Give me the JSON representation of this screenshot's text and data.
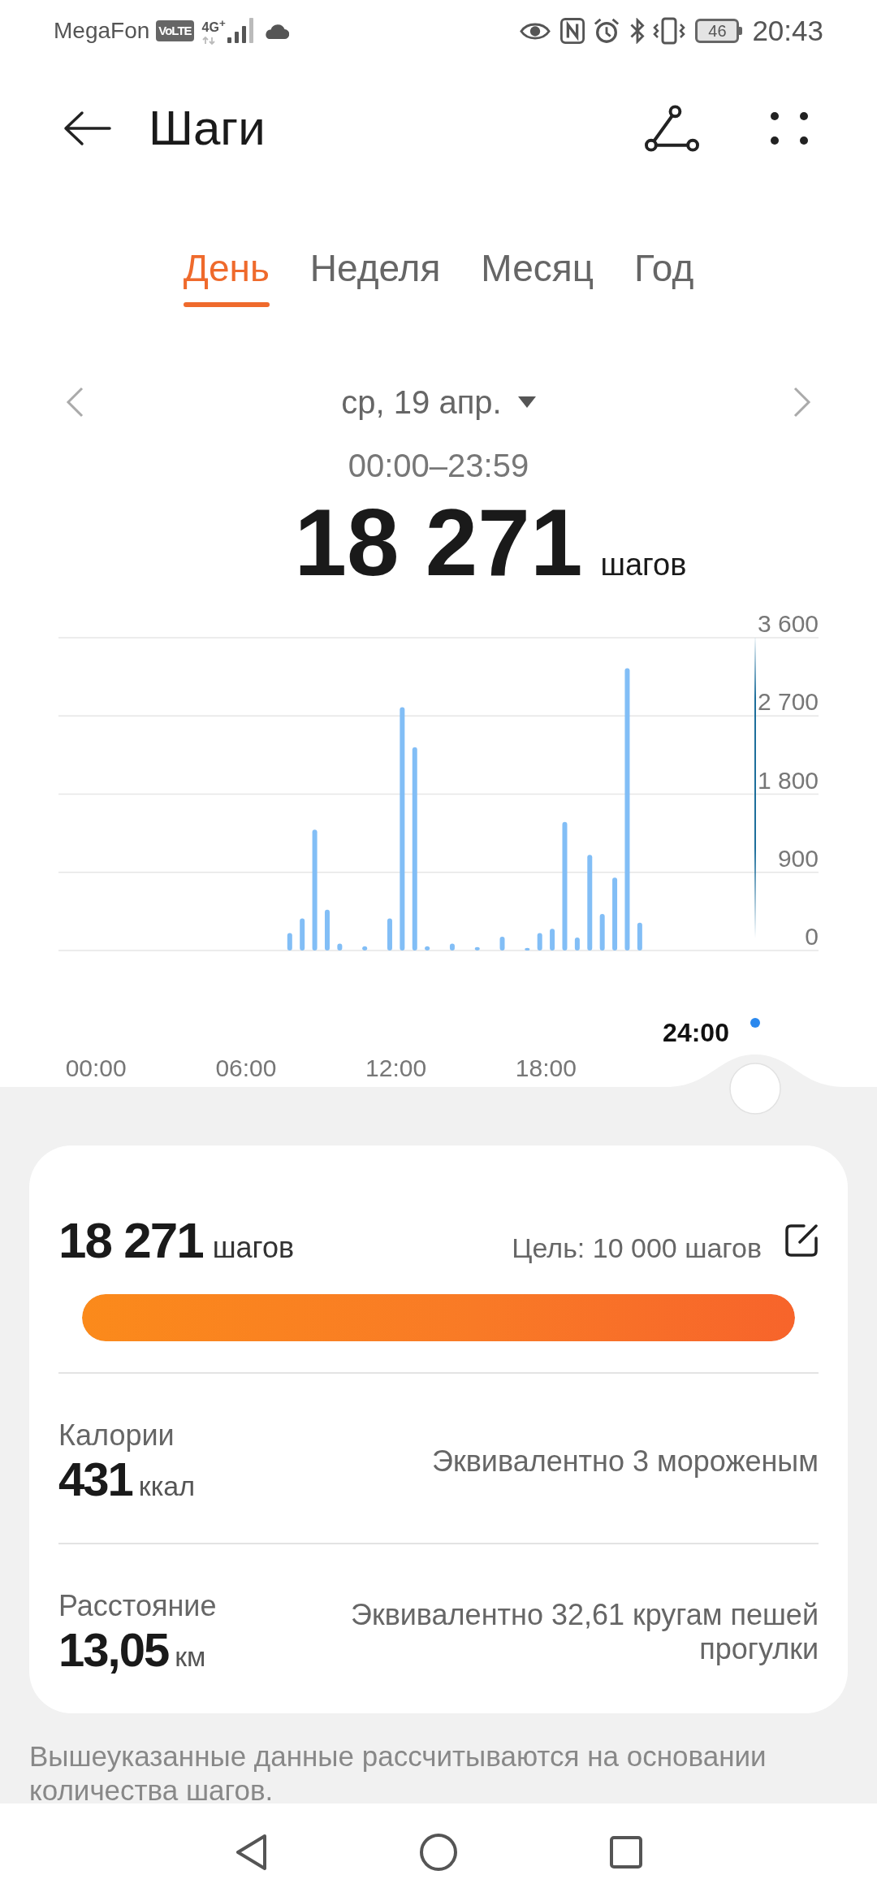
{
  "status_bar": {
    "carrier": "MegaFon",
    "volte": "VoLTE",
    "network": "4G$^{+}$",
    "battery": "46",
    "time": "20:43"
  },
  "header": {
    "title": "Шаги"
  },
  "tabs": [
    {
      "label": "День",
      "selected": true
    },
    {
      "label": "Неделя",
      "selected": false
    },
    {
      "label": "Месяц",
      "selected": false
    },
    {
      "label": "Год",
      "selected": false
    }
  ],
  "date_nav": {
    "date": "ср, 19 апр."
  },
  "summary": {
    "time_range": "00:00–23:59",
    "steps": "18 271",
    "unit": "шагов"
  },
  "chart": {
    "cursor_label": "24:00",
    "chart_data": {
      "type": "bar",
      "grid": true,
      "x": [
        7.75,
        8.25,
        8.75,
        9.25,
        9.75,
        10.75,
        11.75,
        12.25,
        12.75,
        13.25,
        14.25,
        15.25,
        16.25,
        17.25,
        17.75,
        18.25,
        18.75,
        19.25,
        19.75,
        20.25,
        20.75,
        21.25,
        21.75
      ],
      "values": [
        200,
        370,
        1390,
        470,
        80,
        50,
        370,
        2800,
        2340,
        50,
        80,
        40,
        160,
        30,
        200,
        250,
        1480,
        150,
        1100,
        420,
        840,
        3250,
        320
      ],
      "xlim": [
        -1.5,
        28.9
      ],
      "ylim": [
        0,
        3600
      ],
      "xticks": [
        {
          "value": 0,
          "label": "00:00"
        },
        {
          "value": 6,
          "label": "06:00"
        },
        {
          "value": 12,
          "label": "12:00"
        },
        {
          "value": 18,
          "label": "18:00"
        }
      ],
      "yticks": [
        {
          "value": 0,
          "label": "0"
        },
        {
          "value": 900,
          "label": "900"
        },
        {
          "value": 1800,
          "label": "1 800"
        },
        {
          "value": 2700,
          "label": "2 700"
        },
        {
          "value": 3600,
          "label": "3 600"
        }
      ]
    }
  },
  "card": {
    "steps": "18 271",
    "unit": "шагов",
    "goal": "Цель: 10 000 шагов",
    "level": 1,
    "metrics": [
      {
        "label": "Калории",
        "value": "431",
        "unit": "ккал",
        "equivalent": "Эквивалентно 3 мороженым"
      },
      {
        "label": "Расстояние",
        "value": "13,05",
        "unit": "км",
        "equivalent": "Эквивалентно 32,61 кругам пешей прогулки"
      }
    ]
  },
  "footnote": "Вышеуказанные данные рассчитываются на основании количества шагов."
}
